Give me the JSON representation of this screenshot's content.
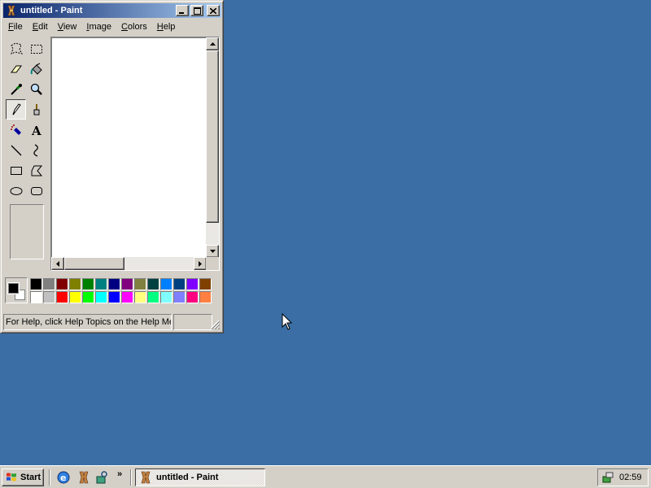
{
  "window": {
    "title": "untitled - Paint",
    "buttons": {
      "minimize": "_",
      "maximize": "□",
      "close": "✕"
    }
  },
  "menu": [
    {
      "key": "F",
      "rest": "ile"
    },
    {
      "key": "E",
      "rest": "dit"
    },
    {
      "key": "V",
      "rest": "iew"
    },
    {
      "key": "I",
      "rest": "mage"
    },
    {
      "key": "C",
      "rest": "olors"
    },
    {
      "key": "H",
      "rest": "elp"
    }
  ],
  "tools": [
    "free-form-select",
    "select",
    "eraser",
    "fill-with-color",
    "pick-color",
    "magnifier",
    "pencil",
    "brush",
    "airbrush",
    "text",
    "line",
    "curve",
    "rectangle",
    "polygon",
    "ellipse",
    "rounded-rectangle"
  ],
  "active_tool": "pencil",
  "colors": {
    "foreground": "#000000",
    "background": "#ffffff",
    "palette_row1": [
      "#000000",
      "#808080",
      "#800000",
      "#808000",
      "#008000",
      "#008080",
      "#000080",
      "#800080",
      "#808040",
      "#004040",
      "#0080ff",
      "#004080",
      "#8000ff",
      "#804000"
    ],
    "palette_row2": [
      "#ffffff",
      "#c0c0c0",
      "#ff0000",
      "#ffff00",
      "#00ff00",
      "#00ffff",
      "#0000ff",
      "#ff00ff",
      "#ffff80",
      "#00ff80",
      "#80ffff",
      "#8080ff",
      "#ff0080",
      "#ff8040"
    ]
  },
  "status": {
    "help_text": "For Help, click Help Topics on the Help Menu."
  },
  "taskbar": {
    "start_label": "Start",
    "quick_launch_chevron": "»",
    "tasks": [
      {
        "label": "untitled - Paint"
      }
    ],
    "clock": "02:59"
  },
  "desktop_color": "#3a6ea5"
}
